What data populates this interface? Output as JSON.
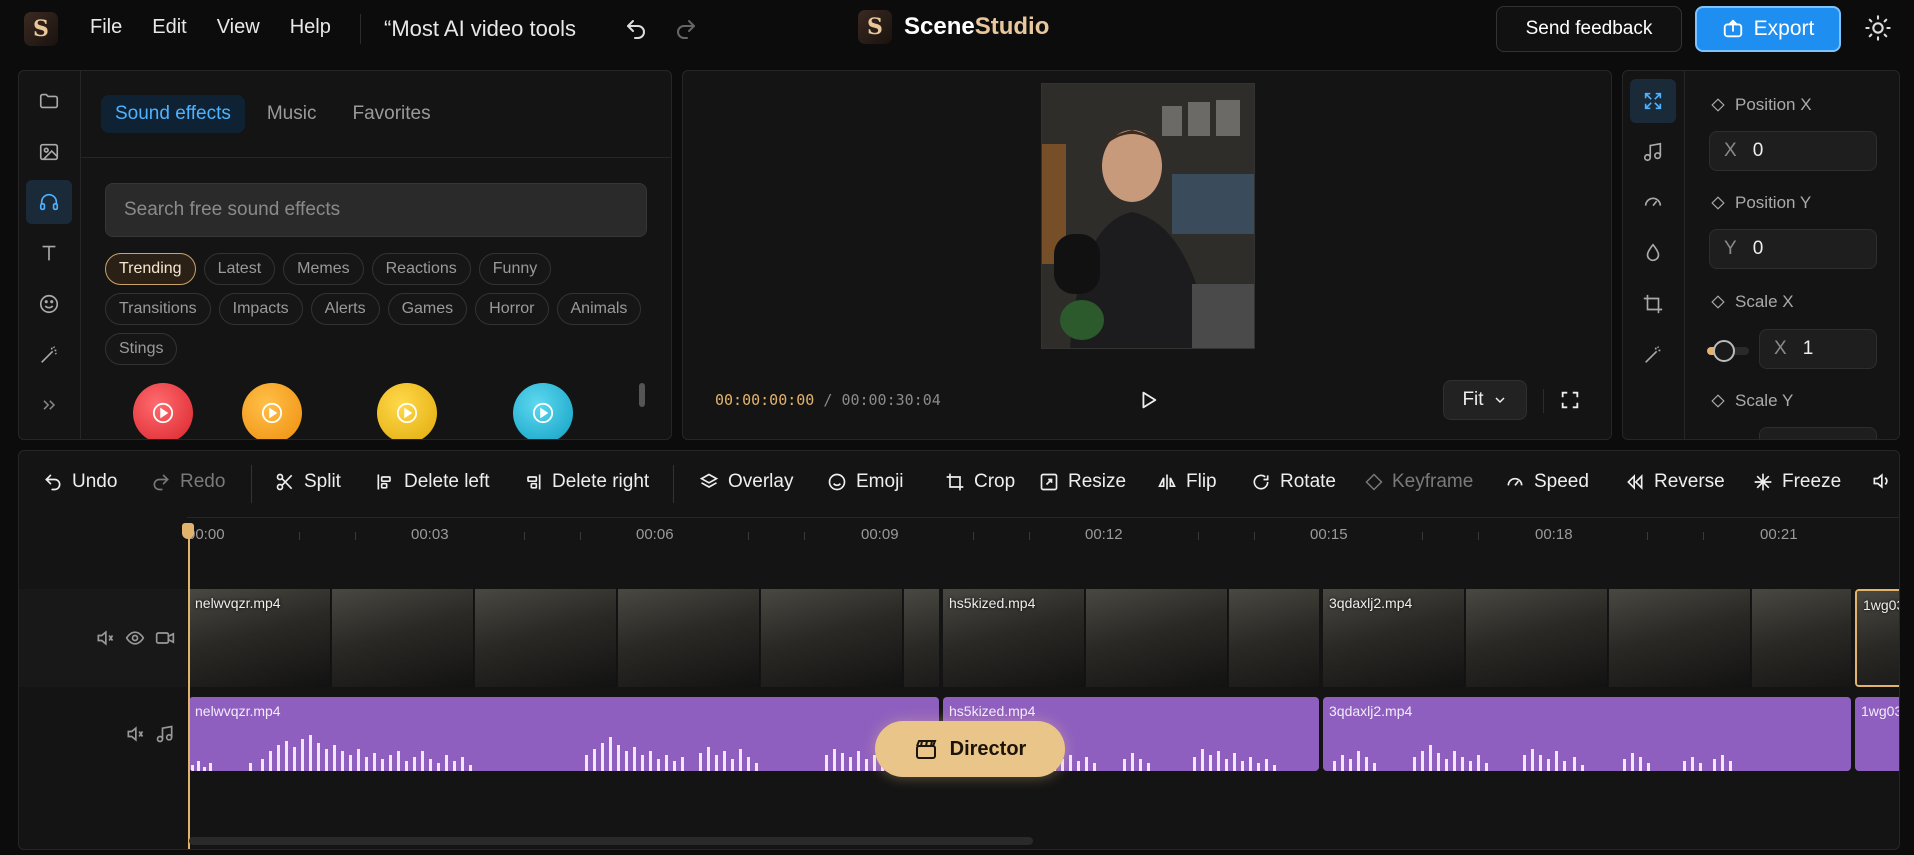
{
  "app": {
    "logo_letter": "S",
    "menu": [
      "File",
      "Edit",
      "View",
      "Help"
    ],
    "doc_title": "“Most AI video tools",
    "brand_a": "Scene",
    "brand_b": "Studio",
    "feedback_label": "Send feedback",
    "export_label": "Export"
  },
  "media_panel": {
    "rail_icons": [
      "folder-icon",
      "image-icon",
      "headphones-icon",
      "text-icon",
      "emoji-icon",
      "magic-wand-icon",
      "expand-icon"
    ],
    "tabs": [
      "Sound effects",
      "Music",
      "Favorites"
    ],
    "active_tab": "Sound effects",
    "search_placeholder": "Search free sound effects",
    "chips": [
      "Trending",
      "Latest",
      "Memes",
      "Reactions",
      "Funny",
      "Transitions",
      "Impacts",
      "Alerts",
      "Games",
      "Horror",
      "Animals",
      "Stings"
    ],
    "active_chip": "Trending",
    "sfx_colors": [
      "#e8393f",
      "#f5a01a",
      "#f2be12",
      "#1fb6d6"
    ]
  },
  "preview": {
    "current_time": "00:00:00:00",
    "separator": "/",
    "total_time": "00:00:30:04",
    "fit_label": "Fit"
  },
  "properties": {
    "rail_icons": [
      "fit-icon",
      "music-note-icon",
      "speed-dial-icon",
      "drop-icon",
      "crop-icon",
      "magic-wand-icon"
    ],
    "position_x_label": "Position X",
    "position_x_axis": "X",
    "position_x_value": "0",
    "position_y_label": "Position Y",
    "position_y_axis": "Y",
    "position_y_value": "0",
    "scale_x_label": "Scale X",
    "scale_x_axis": "X",
    "scale_x_value": "1",
    "scale_y_label": "Scale Y"
  },
  "toolbar": {
    "undo": "Undo",
    "redo": "Redo",
    "split": "Split",
    "delete_left": "Delete left",
    "delete_right": "Delete right",
    "overlay": "Overlay",
    "emoji": "Emoji",
    "crop": "Crop",
    "resize": "Resize",
    "flip": "Flip",
    "rotate": "Rotate",
    "keyframe": "Keyframe",
    "speed": "Speed",
    "reverse": "Reverse",
    "freeze": "Freeze"
  },
  "timeline": {
    "ruler": [
      "00:00",
      "00:03",
      "00:06",
      "00:09",
      "00:12",
      "00:15",
      "00:18",
      "00:21"
    ],
    "video_clips": [
      "nelwvqzr.mp4",
      "hs5kized.mp4",
      "3qdaxlj2.mp4",
      "1wg03"
    ],
    "audio_clips": [
      "nelwvqzr.mp4",
      "hs5kized.mp4",
      "3qdaxlj2.mp4",
      "1wg03"
    ],
    "director_label": "Director"
  },
  "colors": {
    "accent_blue": "#1f8ef1",
    "playhead": "#e2b36c",
    "audio_clip": "#8f5fc0",
    "director": "#e9c58a"
  }
}
